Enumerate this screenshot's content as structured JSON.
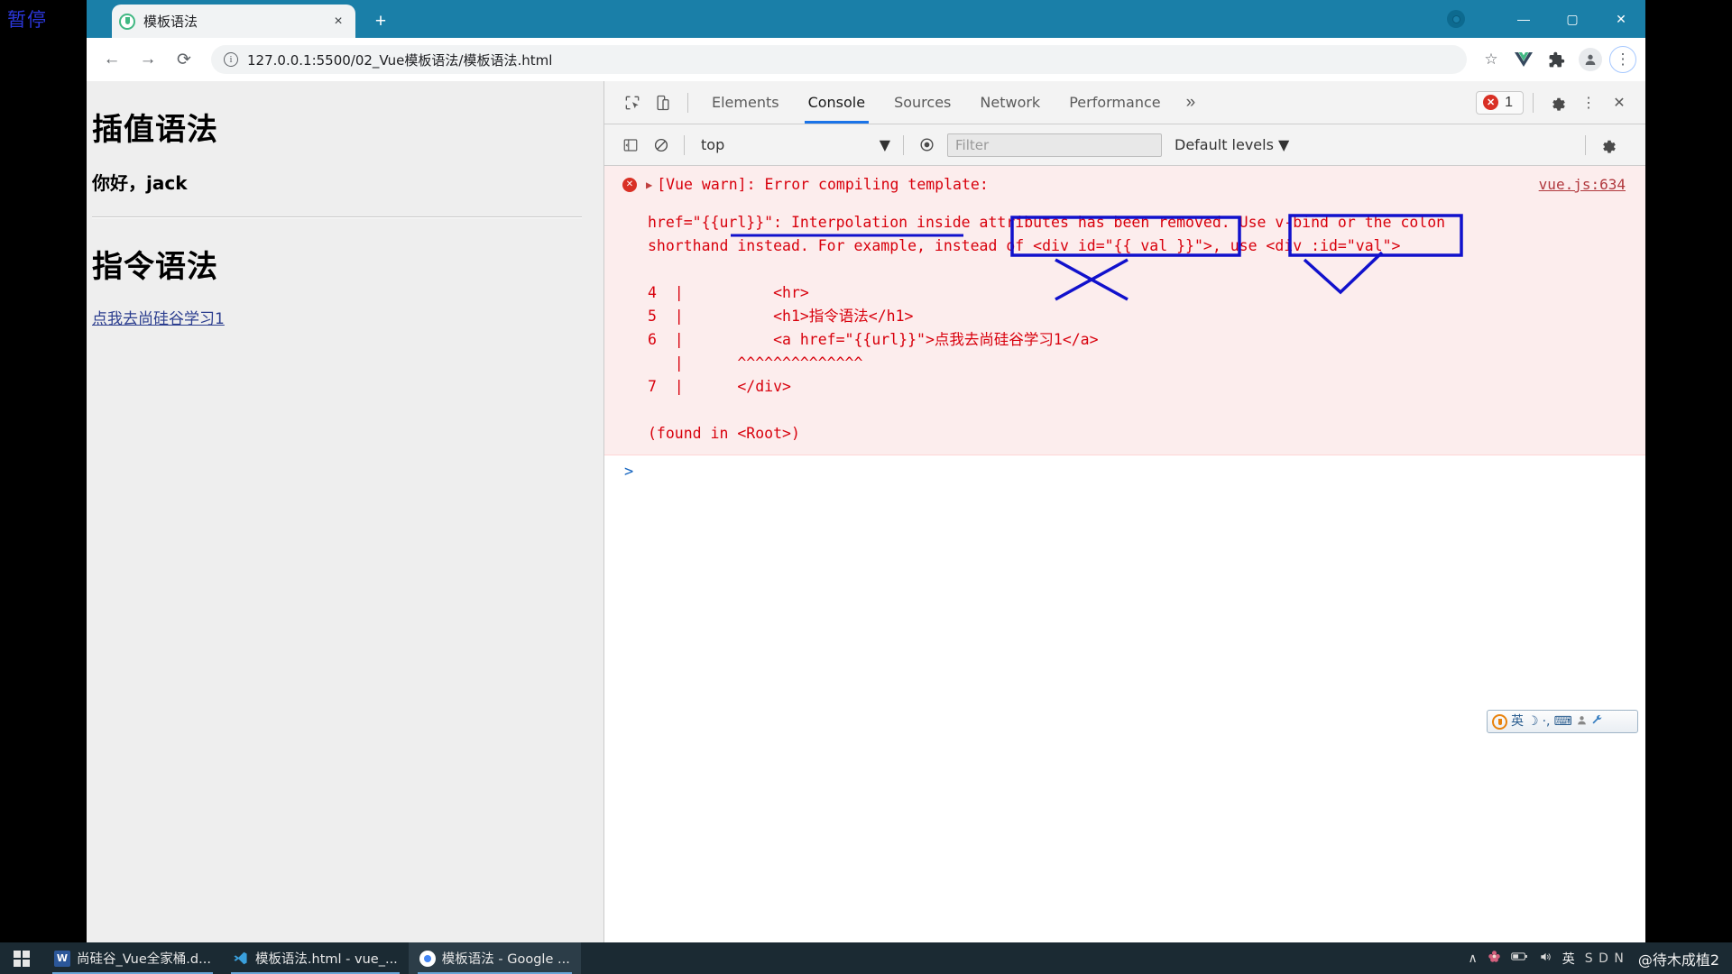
{
  "recording": {
    "label": "暂停"
  },
  "browser": {
    "tab": {
      "title": "模板语法",
      "favicon": "vue-logo-icon",
      "close": "×"
    },
    "new_tab": "+",
    "window_controls": {
      "minimize": "—",
      "maximize": "▢",
      "close": "✕"
    },
    "nav": {
      "back": "←",
      "forward": "→",
      "reload": "⟳"
    },
    "omnibox": {
      "url": "127.0.0.1:5500/02_Vue模板语法/模板语法.html",
      "info_icon": "ⓘ"
    },
    "toolbar_icons": [
      "star-icon",
      "vue-devtools-icon",
      "extensions-icon",
      "profile-icon",
      "chrome-menu-icon"
    ]
  },
  "page": {
    "heading1": "插值语法",
    "greeting": "你好，jack",
    "heading2": "指令语法",
    "link": "点我去尚硅谷学习1"
  },
  "devtools": {
    "tabs": [
      {
        "label": "Elements",
        "active": false
      },
      {
        "label": "Console",
        "active": true
      },
      {
        "label": "Sources",
        "active": false
      },
      {
        "label": "Network",
        "active": false
      },
      {
        "label": "Performance",
        "active": false
      }
    ],
    "more_tabs": "»",
    "error_badge": {
      "count": "1",
      "icon": "error-circle-icon"
    },
    "settings_icon": "gear-icon",
    "menu_icon": "kebab-menu-icon",
    "close_icon": "close-icon",
    "inspect_icon": "inspect-element-icon",
    "device_icon": "device-toolbar-icon",
    "filterbar": {
      "sidebar_toggle": "console-sidebar-icon",
      "clear_icon": "clear-console-icon",
      "context": "top",
      "context_caret": "▼",
      "eye_icon": "live-expression-icon",
      "filter_placeholder": "Filter",
      "filter_value": "",
      "levels": "Default levels",
      "levels_caret": "▼",
      "settings_icon": "console-settings-icon"
    },
    "console": {
      "error_icon": "error-circle-icon",
      "expander": "▶",
      "title": "[Vue warn]: Error compiling template:",
      "source": "vue.js:634",
      "message_line1": "href=\"{{url}}\": Interpolation inside attributes has been removed. Use v-bind or the colon",
      "message_line2": "shorthand instead. For example, instead of <div id=\"{{ val }}\">, use <div :id=\"val\">",
      "code_lines": [
        "4  |          <hr>",
        "5  |          <h1>指令语法</h1>",
        "6  |          <a href=\"{{url}}\">点我去尚硅谷学习1</a>",
        "   |      ^^^^^^^^^^^^^^",
        "7  |      </div>"
      ],
      "found_in": "(found in <Root>)",
      "prompt": ">",
      "annotation_color": "#1111cc"
    }
  },
  "ime_bar": {
    "logo": "sogou-logo-icon",
    "mode": "英",
    "moon_icon": "☽",
    "punct_icon": "·,",
    "keyboard_icon": "⌨",
    "user_icon": "person-icon",
    "wrench_icon": "🔧"
  },
  "taskbar": {
    "start": "windows-start-icon",
    "items": [
      {
        "label": "尚硅谷_Vue全家桶.d...",
        "icon": "word-icon",
        "active": false
      },
      {
        "label": "模板语法.html - vue_...",
        "icon": "vscode-icon",
        "active": false
      },
      {
        "label": "模板语法 - Google ...",
        "icon": "chrome-icon",
        "active": true
      }
    ],
    "tray": {
      "chevron": "∧",
      "flower_icon": "flower-icon",
      "battery_icon": "battery-icon",
      "volume_icon": "volume-icon",
      "ime_lang": "英",
      "sdn": "S D N",
      "watermark": "@待木成植2"
    }
  }
}
